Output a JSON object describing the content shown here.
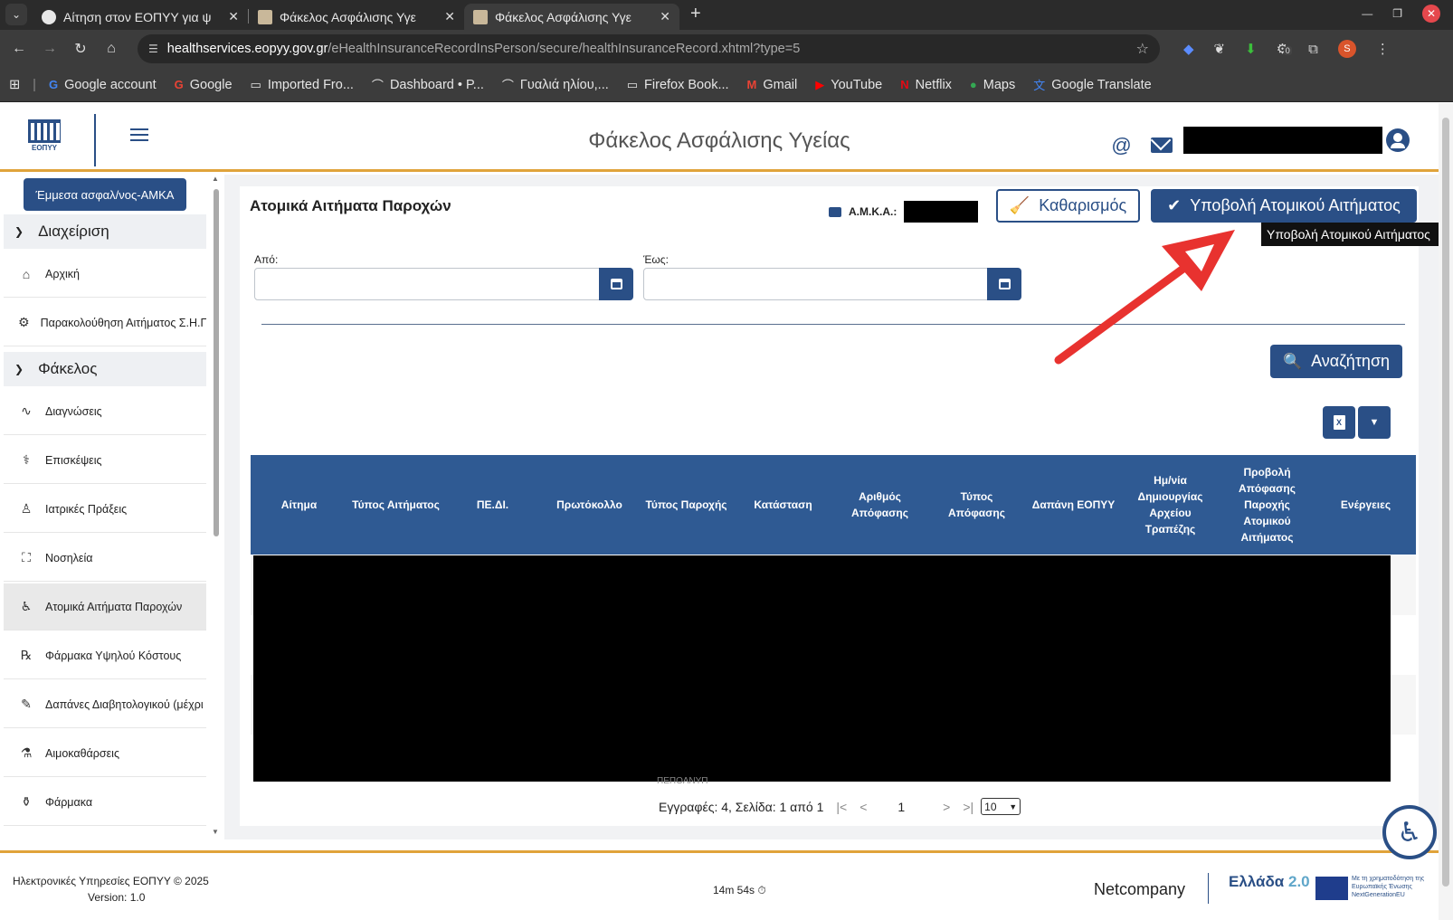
{
  "browser": {
    "tabs": [
      {
        "title": "Αίτηση στον ΕΟΠΥΥ για ψ"
      },
      {
        "title": "Φάκελος Ασφάλισης Υγε"
      },
      {
        "title": "Φάκελος Ασφάλισης Υγε"
      }
    ],
    "url_site": "healthservices.eopyy.gov.gr",
    "url_path": "/eHealthInsuranceRecordInsPerson/secure/healthInsuranceRecord.xhtml?type=5",
    "bookmarks": [
      "Google account",
      "Google",
      "Imported Fro...",
      "Dashboard • P...",
      "Γυαλιά ηλίου,...",
      "Firefox Book...",
      "Gmail",
      "YouTube",
      "Netflix",
      "Maps",
      "Google Translate"
    ],
    "profile_initial": "S",
    "ext_badge": "0"
  },
  "header": {
    "logo_text": "ΕΟΠΥΥ",
    "title": "Φάκελος Ασφάλισης Υγείας",
    "at_symbol": "@"
  },
  "sidebar": {
    "top_button": "Έμμεσα ασφαλ/νος-ΑΜΚΑ",
    "sections": [
      {
        "label": "Διαχείριση",
        "items": [
          "Αρχική",
          "Παρακολούθηση Αιτήματος Σ.Η.Π"
        ]
      },
      {
        "label": "Φάκελος",
        "items": [
          "Διαγνώσεις",
          "Επισκέψεις",
          "Ιατρικές Πράξεις",
          "Νοσηλεία",
          "Ατομικά Αιτήματα Παροχών",
          "Φάρμακα Υψηλού Κόστους",
          "Δαπάνες Διαβητολογικού (μέχρι",
          "Αιμοκαθάρσεις",
          "Φάρμακα"
        ]
      }
    ]
  },
  "main": {
    "title": "Ατομικά Αιτήματα Παροχών",
    "amka_label": "Α.Μ.Κ.Α.:",
    "clear_button": "Καθαρισμός",
    "submit_button": "Υποβολή Ατομικού Αιτήματος",
    "tooltip": "Υποβολή Ατομικού Αιτήματος",
    "from_label": "Από:",
    "to_label": "Έως:",
    "search_button": "Αναζήτηση",
    "excel_label": "X",
    "table_headers": [
      "Αίτημα",
      "Τύπος Αιτήματος",
      "ΠΕ.ΔΙ.",
      "Πρωτόκολλο",
      "Τύπος Παροχής",
      "Κατάσταση",
      "Αριθμός Απόφασης",
      "Τύπος Απόφασης",
      "Δαπάνη ΕΟΠΥΥ",
      "Ημ/νία Δημιουργίας Αρχείου Τραπέζης",
      "Προβολή Απόφασης Παροχής Ατομικού Αιτήματος",
      "Ενέργειες"
    ],
    "leak_text": "ΠΕΠΟΑΝΥΠ",
    "pager": {
      "summary": "Εγγραφές: 4, Σελίδα: 1 από 1",
      "current_page": "1",
      "page_size": "10"
    }
  },
  "footer": {
    "copyright": "Ηλεκτρονικές Υπηρεσίες ΕΟΠΥΥ © 2025",
    "version": "Version: 1.0",
    "timer": "14m 54s",
    "vendor": "Netcompany",
    "greece_brand": "Ελλάδα",
    "greece_version": "2.0",
    "eu_text": "Με τη χρηματοδότηση της Ευρωπαϊκής Ένωσης NextGenerationEU"
  },
  "colors": {
    "primary": "#2a4f86",
    "table_header": "#2f5a93",
    "accent_orange": "#e0a33a",
    "annotation_arrow": "#e8322f"
  }
}
